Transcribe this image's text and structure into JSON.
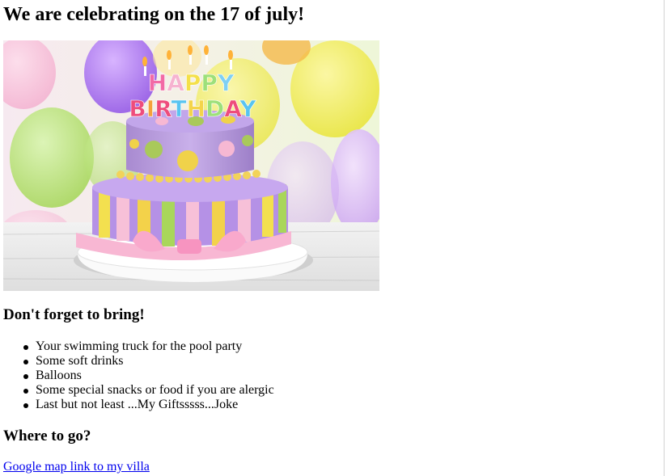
{
  "heading": "We are celebrating on the 17 of july!",
  "image": {
    "cake_topper": "HAPPY BIRTHDAY"
  },
  "bring_heading": "Don't forget to bring!",
  "bring_items": [
    "Your swimming truck for the pool party",
    "Some soft drinks",
    "Balloons",
    "Some special snacks or food if you are alergic",
    "Last but not least ...My Giftsssss...Joke"
  ],
  "where_heading": "Where to go?",
  "map_link": "Google map link to my villa",
  "colors": {
    "link": "#0000ee",
    "text": "#000000",
    "background": "#ffffff"
  }
}
